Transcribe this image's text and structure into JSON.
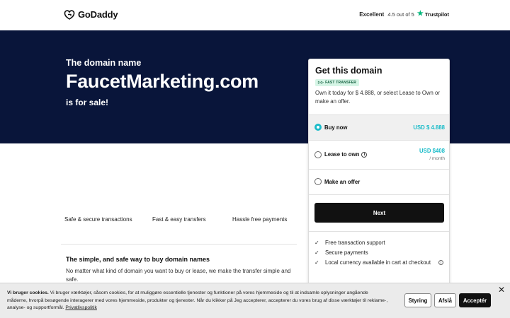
{
  "header": {
    "brand": "GoDaddy",
    "rating_label": "Excellent",
    "rating_score": "4.5 out of 5",
    "rating_source": "Trustpilot"
  },
  "hero": {
    "pre": "The domain name",
    "domain": "FaucetMarketing.com",
    "post": "is for sale!"
  },
  "features": {
    "items": [
      "Safe & secure transactions",
      "Fast & easy transfers",
      "Hassle free payments"
    ]
  },
  "info": {
    "title": "The simple, and safe way to buy domain names",
    "body": "No matter what kind of domain you want to buy or lease, we make the transfer simple and safe."
  },
  "card": {
    "title": "Get this domain",
    "badge": "FAST TRANSFER",
    "description": "Own it today for $ 4.888, or select Lease to Own or make an offer.",
    "options": [
      {
        "label": "Buy now",
        "price": "USD $ 4.888",
        "sub": ""
      },
      {
        "label": "Lease to own",
        "price": "USD $408",
        "sub": "/ month"
      },
      {
        "label": "Make an offer",
        "price": "",
        "sub": ""
      }
    ],
    "next_label": "Next",
    "benefits": [
      "Free transaction support",
      "Secure payments",
      "Local currency available in cart at checkout"
    ]
  },
  "cookie": {
    "title": "Vi bruger cookies.",
    "text": "Vi bruger værktøjer, såsom cookies, for at muliggøre essentielle tjenester og funktioner på vores hjemmeside og til at indsamle oplysninger angående måderne, hvorpå besøgende interagerer med vores hjemmeside, produkter og tjenester. Når du klikker på Jeg accepterer, accepterer du vores brug af disse værktøjer til reklame-, analyse- og supportformål.",
    "link": "Privatlivspolitik",
    "btn_manage": "Styring",
    "btn_reject": "Afslå",
    "btn_accept": "Acceptér"
  },
  "colors": {
    "hero_bg": "#09153a",
    "accent": "#1bbcc9",
    "badge_bg": "#d6f5e6",
    "trustpilot": "#00b67a"
  }
}
